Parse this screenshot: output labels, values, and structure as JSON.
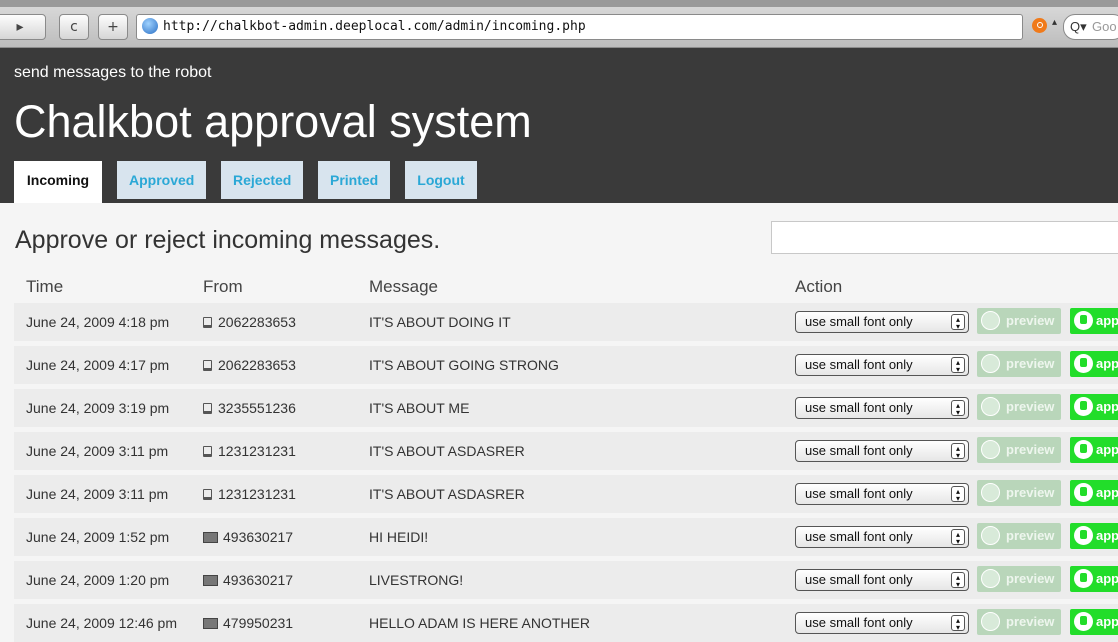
{
  "browser": {
    "back_glyph": "▸",
    "reload_glyph": "c",
    "add_glyph": "+",
    "url": "http://chalkbot-admin.deeplocal.com/admin/incoming.php",
    "search_glyph": "Q▾",
    "search_placeholder": "Goo"
  },
  "header": {
    "tagline": "send messages to the robot",
    "title": "Chalkbot approval system",
    "tabs": [
      {
        "label": "Incoming",
        "active": true
      },
      {
        "label": "Approved"
      },
      {
        "label": "Rejected"
      },
      {
        "label": "Printed"
      },
      {
        "label": "Logout"
      }
    ]
  },
  "main": {
    "heading": "Approve or reject incoming messages.",
    "columns": [
      "Time",
      "From",
      "Message",
      "Action"
    ],
    "select_value": "use small font only",
    "preview_label": "preview",
    "approve_label": "app",
    "rows": [
      {
        "time": "June 24, 2009 4:18 pm",
        "source": "phone",
        "from": "2062283653",
        "message": "IT'S ABOUT DOING IT"
      },
      {
        "time": "June 24, 2009 4:17 pm",
        "source": "phone",
        "from": "2062283653",
        "message": "IT'S ABOUT GOING STRONG"
      },
      {
        "time": "June 24, 2009 3:19 pm",
        "source": "phone",
        "from": "3235551236",
        "message": "IT'S ABOUT ME"
      },
      {
        "time": "June 24, 2009 3:11 pm",
        "source": "phone",
        "from": "1231231231",
        "message": "IT'S ABOUT ASDASRER"
      },
      {
        "time": "June 24, 2009 3:11 pm",
        "source": "phone",
        "from": "1231231231",
        "message": "IT'S ABOUT ASDASRER"
      },
      {
        "time": "June 24, 2009 1:52 pm",
        "source": "web",
        "from": "493630217",
        "message": "HI HEIDI!"
      },
      {
        "time": "June 24, 2009 1:20 pm",
        "source": "web",
        "from": "493630217",
        "message": "LIVESTRONG!"
      },
      {
        "time": "June 24, 2009 12:46 pm",
        "source": "web",
        "from": "479950231",
        "message": "HELLO ADAM IS HERE ANOTHER"
      }
    ]
  }
}
